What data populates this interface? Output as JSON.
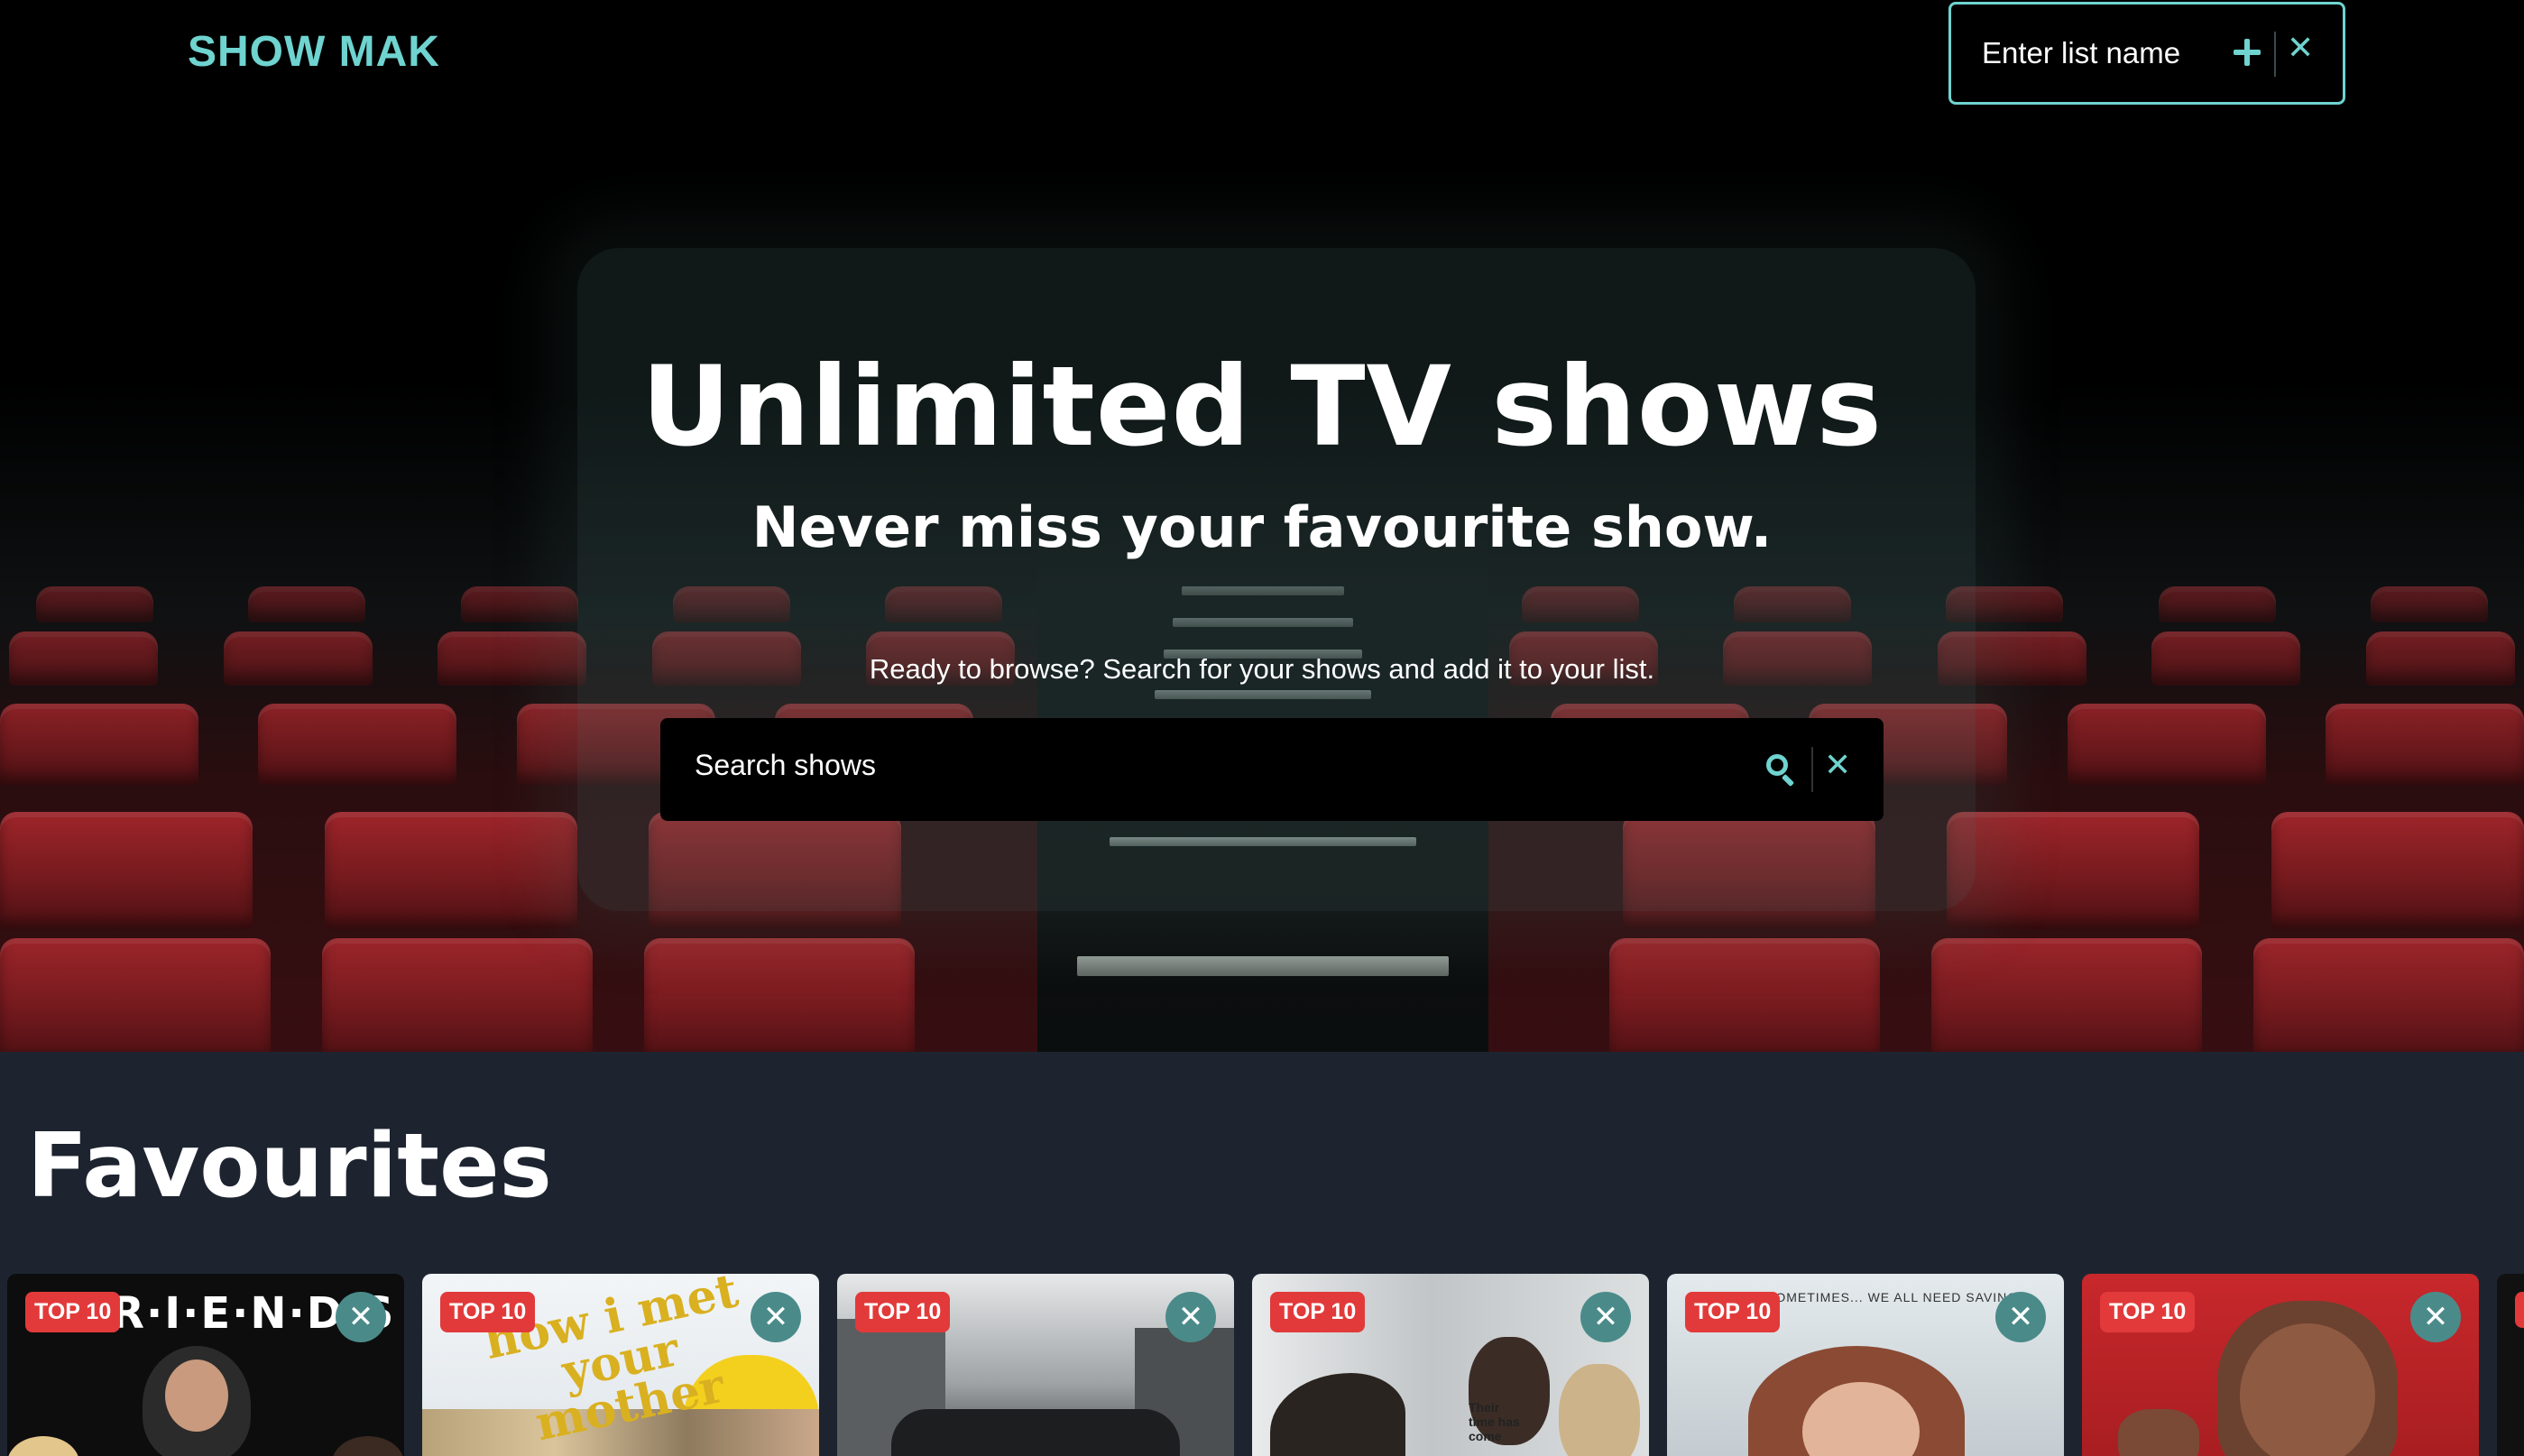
{
  "header": {
    "brand": "SHOW MAK",
    "list_name_placeholder": "Enter list name"
  },
  "hero": {
    "headline": "Unlimited TV shows",
    "subheadline": "Never miss your favourite show.",
    "prompt": "Ready to browse? Search for your shows and add it to your list.",
    "search_placeholder": "Search shows"
  },
  "favourites": {
    "title": "Favourites",
    "cards": [
      {
        "badge": "TOP 10",
        "art_text": "F·R·I·E·N·D·S",
        "show_name": "Friends",
        "bg": "#0d0d0d"
      },
      {
        "badge": "TOP 10",
        "art_text": "how i met your mother",
        "show_name": "How I Met Your Mother",
        "bg": "#e9edf0"
      },
      {
        "badge": "TOP 10",
        "art_text": "",
        "show_name": "",
        "bg": "#cfd1d2"
      },
      {
        "badge": "TOP 10",
        "art_text": "Their time has come",
        "show_name": "",
        "bg": "#d6d9db"
      },
      {
        "badge": "TOP 10",
        "art_text": "SOMETIMES... WE ALL NEED SAVING",
        "show_name": "",
        "bg": "#c9d2d6"
      },
      {
        "badge": "TOP 10",
        "art_text": "",
        "show_name": "",
        "bg": "#c8282c"
      }
    ]
  },
  "colors": {
    "accent": "#6fd3d0",
    "badge": "#e23a3a",
    "remove_button": "#4a8b8a",
    "page_bg": "#1d2430"
  },
  "icons": {
    "add": "plus-icon",
    "clear": "close-icon",
    "search": "search-icon",
    "remove": "close-icon"
  }
}
